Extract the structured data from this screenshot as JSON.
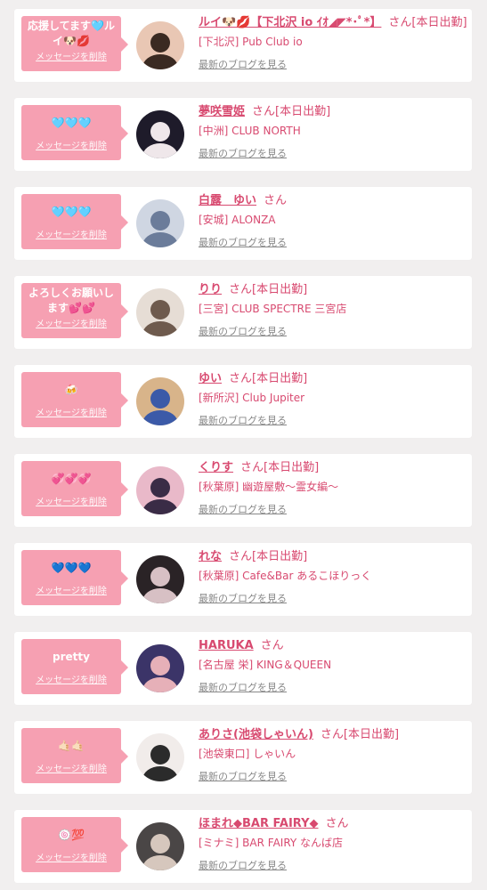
{
  "theme": {
    "accent": "#d84a70",
    "bubble": "#f6a0b2",
    "background": "#f1efef",
    "card": "#ffffff",
    "muted": "#888888"
  },
  "labels": {
    "delete": "メッセージを削除",
    "blog": "最新のブログを見る"
  },
  "messages": [
    {
      "message": "応援してます🩵ルイ🐶💋",
      "name": "ルイ🐶💋【下北沢 io ｲｵ◢◤*･ﾟ*】",
      "suffix": "さん[本日出勤]",
      "store": "[下北沢] Pub Club io",
      "avatar_colors": [
        "#e9c7b4",
        "#3a2a22"
      ]
    },
    {
      "message": "🩵🩵🩵",
      "name": "夢咲雪姫",
      "suffix": "さん[本日出勤]",
      "store": "[中洲] CLUB NORTH",
      "avatar_colors": [
        "#1e1b2a",
        "#efe7ea"
      ]
    },
    {
      "message": "🩵🩵🩵",
      "name": "白露　ゆい",
      "suffix": "さん",
      "store": "[安城] ALONZA",
      "avatar_colors": [
        "#cfd6e2",
        "#6b7c9a"
      ]
    },
    {
      "message": "よろしくお願いします💕💕",
      "name": "りり",
      "suffix": "さん[本日出勤]",
      "store": "[三宮] CLUB SPECTRE 三宮店",
      "avatar_colors": [
        "#e6ddd5",
        "#6e5a4d"
      ]
    },
    {
      "message": "🍻",
      "name": "ゆい",
      "suffix": "さん[本日出勤]",
      "store": "[新所沢] Club Jupiter",
      "avatar_colors": [
        "#d8b48a",
        "#3b5aa8"
      ]
    },
    {
      "message": "💞💞💞",
      "name": "くりす",
      "suffix": "さん[本日出勤]",
      "store": "[秋葉原] 幽遊屋敷〜霊女編〜",
      "avatar_colors": [
        "#e9b9c9",
        "#3a2c46"
      ]
    },
    {
      "message": "💙💙💙",
      "name": "れな",
      "suffix": "さん[本日出勤]",
      "store": "[秋葉原] Cafe&Bar あるこほりっく",
      "avatar_colors": [
        "#2a2326",
        "#d7c0c4"
      ]
    },
    {
      "message": "pretty",
      "name": "HARUKA",
      "suffix": "さん",
      "store": "[名古屋 栄] KING＆QUEEN",
      "avatar_colors": [
        "#3b3468",
        "#e6b0b8"
      ]
    },
    {
      "message": "🤙🏻🤙🏻",
      "name": "ありさ(池袋しゃいん)",
      "suffix": "さん[本日出勤]",
      "store": "[池袋東口] しゃいん",
      "avatar_colors": [
        "#f1ecea",
        "#2b2b2b"
      ]
    },
    {
      "message": "🍥💯",
      "name": "ほまれ◆BAR FAIRY◆",
      "suffix": "さん",
      "store": "[ミナミ] BAR FAIRY なんば店",
      "avatar_colors": [
        "#4a4646",
        "#d6c7bd"
      ]
    }
  ]
}
